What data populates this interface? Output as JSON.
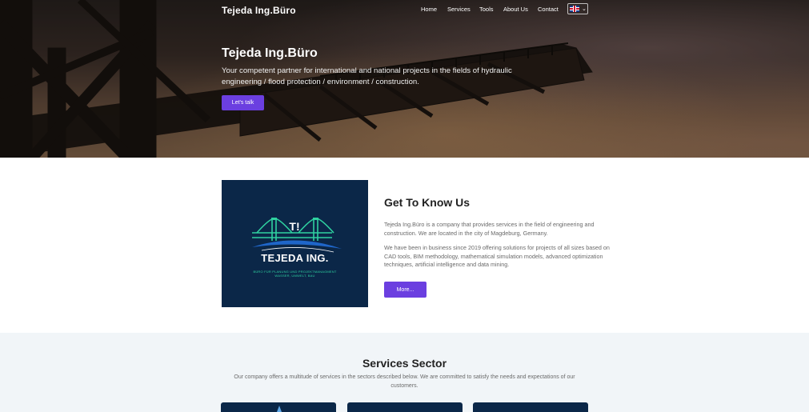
{
  "nav": {
    "brand": "Tejeda Ing.Büro",
    "items": [
      "Home",
      "Services",
      "Tools",
      "About Us",
      "Contact"
    ],
    "language_flag": "uk-flag-icon"
  },
  "hero": {
    "title": "Tejeda Ing.Büro",
    "subtitle": "Your competent partner for international and national projects in the fields of hydraulic engineering / flood protection / environment / construction.",
    "cta": "Let's talk"
  },
  "about": {
    "logo": {
      "mark": "T!",
      "name": "TEJEDA ING.",
      "line1": "BÜRO FÜR PLANUNG UND PROJEKTMANAGMENT",
      "line2": "WASSER, UMWELT, BAU"
    },
    "title": "Get To Know Us",
    "p1": "Tejeda Ing.Büro is a company that provides services in the field of engineering and construction. We are located in the city of Magdeburg, Germany.",
    "p2": "We have been in business since 2019 offering solutions for projects of all sizes based on CAD tools, BIM methodology, mathematical simulation models, advanced optimization techniques, artificial intelligence and data mining.",
    "button": "More..."
  },
  "services": {
    "title": "Services Sector",
    "description": "Our company offers a multitude of services in the sectors described below. We are committed to satisfy the needs and expectations of our customers."
  },
  "colors": {
    "accent": "#6b3fe0",
    "navy": "#0b2748",
    "teal": "#2fd1a0",
    "services_bg": "#f1f5f8"
  }
}
